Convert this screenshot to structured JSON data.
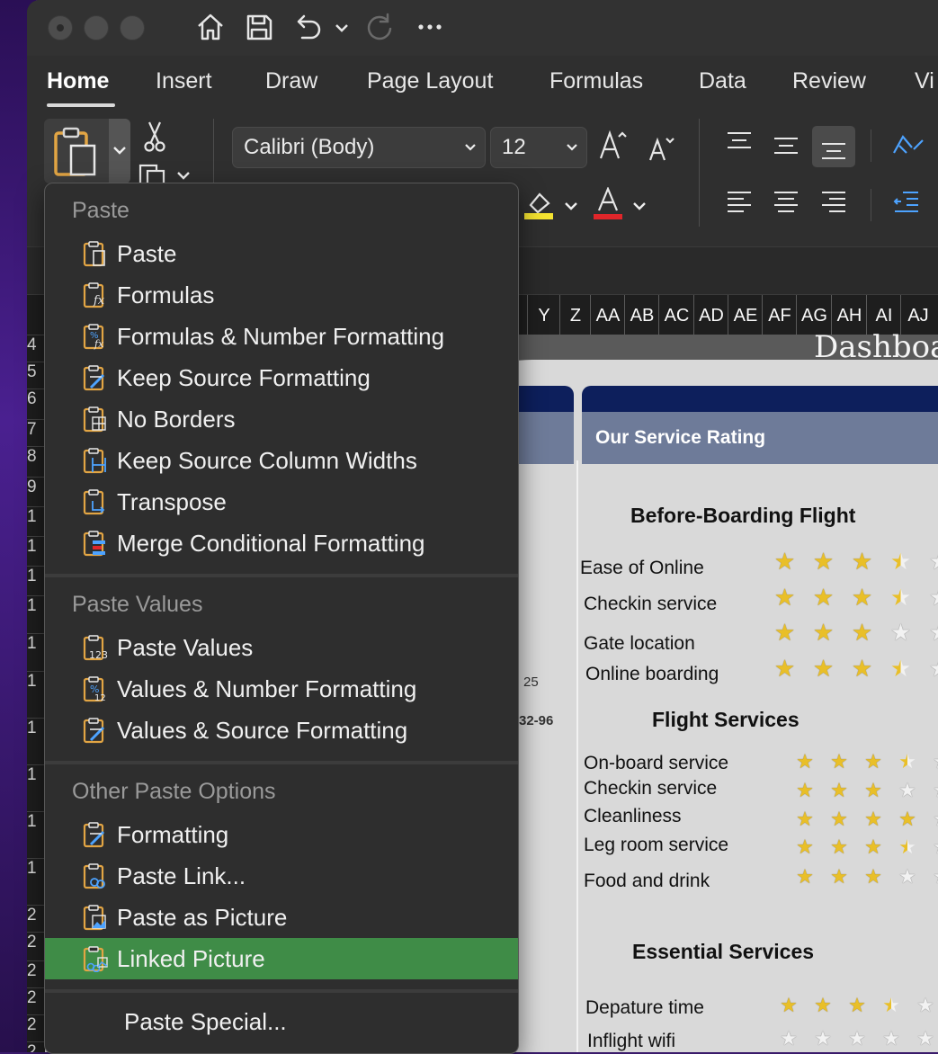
{
  "toolbar": {
    "tabs": [
      "Home",
      "Insert",
      "Draw",
      "Page Layout",
      "Formulas",
      "Data",
      "Review",
      "Vi"
    ],
    "font_name": "Calibri (Body)",
    "font_size": "12",
    "colors": {
      "highlight": "#f5e431",
      "font_color": "#e0262a",
      "accent": "#3f8c47"
    }
  },
  "columns": [
    "Y",
    "Z",
    "AA",
    "AB",
    "AC",
    "AD",
    "AE",
    "AF",
    "AG",
    "AH",
    "AI",
    "AJ"
  ],
  "row_headers": [
    "4",
    "5",
    "6",
    "7",
    "8",
    "9",
    "1",
    "1",
    "1",
    "1",
    "1",
    "1",
    "1",
    "1",
    "1",
    "1",
    "2",
    "2",
    "2",
    "2",
    "2",
    "2"
  ],
  "sheet": {
    "banner_title": "Dashboar",
    "service_rating_header": "Our Service Rating",
    "cell_25": "25",
    "cell_range": "32-96",
    "sections": [
      {
        "title": "Before-Boarding Flight",
        "rows": [
          {
            "label": "Ease of Online",
            "rating": 3.5
          },
          {
            "label": "Checkin service",
            "rating": 3.5
          },
          {
            "label": "Gate location",
            "rating": 3
          },
          {
            "label": "Online boarding",
            "rating": 3.5
          }
        ]
      },
      {
        "title": "Flight Services",
        "rows": [
          {
            "label": "On-board service",
            "rating": 3.5
          },
          {
            "label": "Checkin service",
            "rating": 3
          },
          {
            "label": "Cleanliness",
            "rating": 4
          },
          {
            "label": "Leg room service",
            "rating": 3.5
          },
          {
            "label": "Food and drink",
            "rating": 3
          }
        ]
      },
      {
        "title": "Essential Services",
        "rows": [
          {
            "label": "Depature time",
            "rating": 3.5
          },
          {
            "label": "Inflight wifi",
            "rating": 0
          }
        ]
      }
    ]
  },
  "menu": {
    "paste_header": "Paste",
    "paste_items": [
      {
        "label": "Paste",
        "icon": "clipboard-icon"
      },
      {
        "label": "Formulas",
        "icon": "clipboard-fx-icon"
      },
      {
        "label": "Formulas & Number Formatting",
        "icon": "clipboard-percent-fx-icon"
      },
      {
        "label": "Keep Source Formatting",
        "icon": "clipboard-brush-icon"
      },
      {
        "label": "No Borders",
        "icon": "clipboard-grid-icon"
      },
      {
        "label": "Keep Source Column Widths",
        "icon": "clipboard-width-icon"
      },
      {
        "label": "Transpose",
        "icon": "clipboard-transpose-icon"
      },
      {
        "label": "Merge Conditional Formatting",
        "icon": "clipboard-bars-icon"
      }
    ],
    "values_header": "Paste Values",
    "values_items": [
      {
        "label": "Paste Values",
        "icon": "clipboard-123-icon"
      },
      {
        "label": "Values & Number Formatting",
        "icon": "clipboard-percent-icon"
      },
      {
        "label": "Values & Source Formatting",
        "icon": "clipboard-brush-icon"
      }
    ],
    "other_header": "Other Paste Options",
    "other_items": [
      {
        "label": "Formatting",
        "icon": "clipboard-brush-icon"
      },
      {
        "label": "Paste Link...",
        "icon": "clipboard-link-icon"
      },
      {
        "label": "Paste as Picture",
        "icon": "clipboard-picture-icon"
      },
      {
        "label": "Linked Picture",
        "icon": "clipboard-linked-picture-icon",
        "selected": true
      }
    ],
    "paste_special": "Paste Special..."
  }
}
